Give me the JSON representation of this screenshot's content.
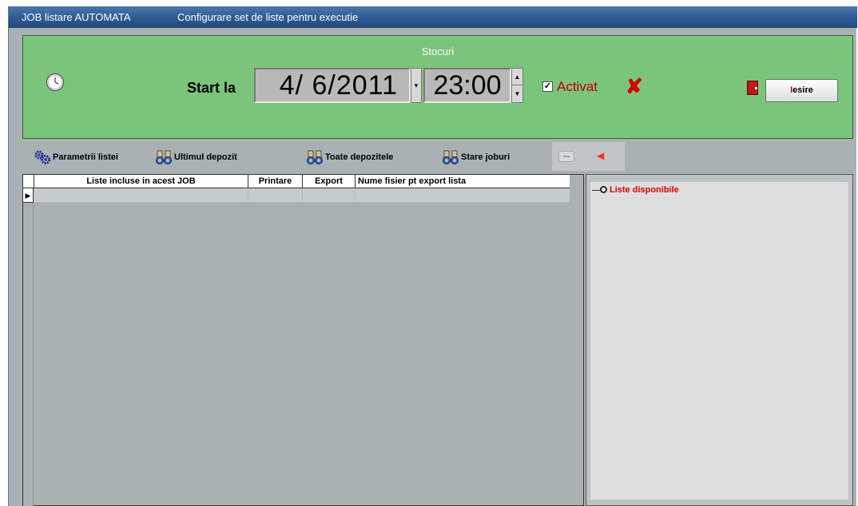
{
  "window": {
    "title": "JOB listare AUTOMATA",
    "subtitle": "Configurare set de liste pentru executie"
  },
  "panel": {
    "title": "Stocuri",
    "start_label": "Start la",
    "date": "4/ 6/2011",
    "time": "23:00",
    "activat_checked": true,
    "activat_label": "Activat",
    "exit_label_prefix": "I",
    "exit_label_rest": "esire",
    "colors": {
      "panel_bg": "#7bc47b",
      "accent_red": "#d40000"
    }
  },
  "toolbar": {
    "parametrii": "Parametrii listei",
    "ultimul": "Ultimul depozit",
    "toate": "Toate depozitele",
    "stare": "Stare joburi"
  },
  "grid": {
    "columns": [
      "Liste incluse in acest JOB",
      "Printare",
      "Export",
      "Nume fisier pt export lista"
    ],
    "rows": []
  },
  "tree": {
    "root_label": "Liste disponibile"
  },
  "icons": {
    "clock": "clock-icon",
    "gears": "gears-icon",
    "binoculars": "binoculars-icon",
    "delete": "delete-x-icon",
    "door": "exit-door-icon"
  }
}
